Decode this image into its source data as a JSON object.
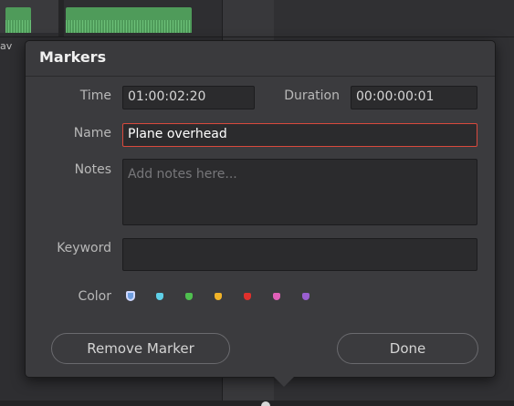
{
  "background": {
    "left_label": "av"
  },
  "dialog": {
    "title": "Markers",
    "time": {
      "label": "Time",
      "value": "01:00:02:20"
    },
    "duration": {
      "label": "Duration",
      "value": "00:00:00:01"
    },
    "name": {
      "label": "Name",
      "value": "Plane overhead"
    },
    "notes": {
      "label": "Notes",
      "placeholder": "Add notes here..."
    },
    "keyword": {
      "label": "Keyword",
      "value": ""
    },
    "color": {
      "label": "Color",
      "swatches": [
        {
          "name": "blue",
          "hex": "#6f9fe0",
          "selected": true
        },
        {
          "name": "cyan",
          "hex": "#5fd0e8",
          "selected": false
        },
        {
          "name": "green",
          "hex": "#4fbf4f",
          "selected": false
        },
        {
          "name": "yellow",
          "hex": "#f0b328",
          "selected": false
        },
        {
          "name": "red",
          "hex": "#e0302c",
          "selected": false
        },
        {
          "name": "pink",
          "hex": "#e060b8",
          "selected": false
        },
        {
          "name": "purple",
          "hex": "#9a5fd0",
          "selected": false
        }
      ]
    },
    "buttons": {
      "remove_label": "Remove Marker",
      "done_label": "Done"
    }
  }
}
